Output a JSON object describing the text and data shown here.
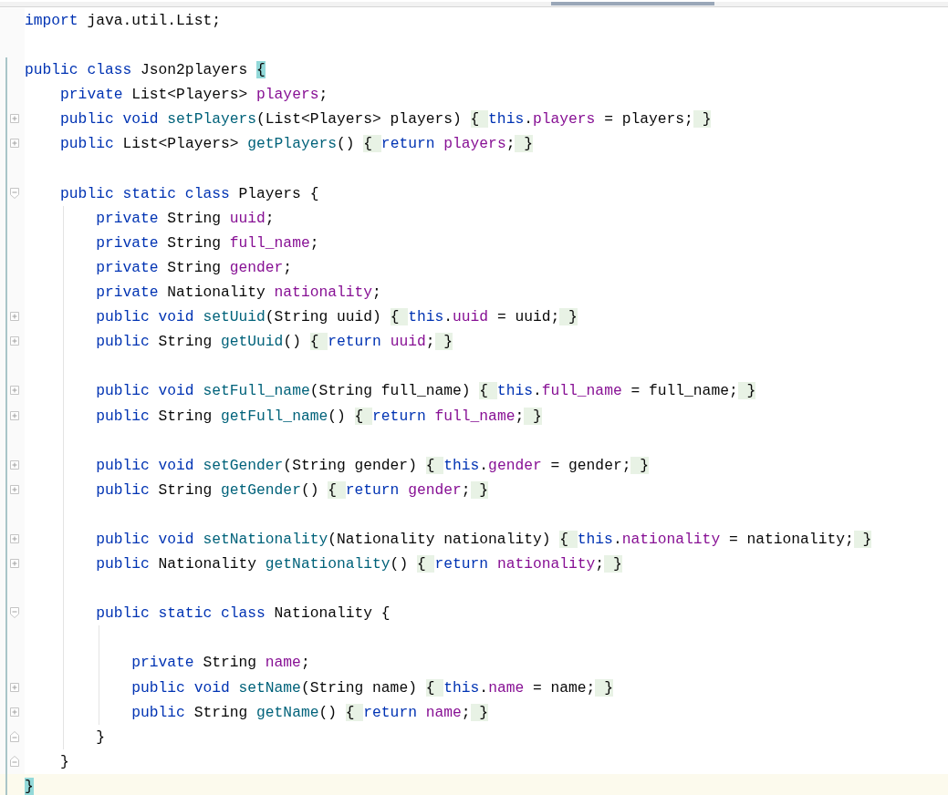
{
  "editor": {
    "lines": [
      {
        "kind": "plain",
        "modified": false,
        "current": false,
        "segments": [
          {
            "kind": "keyword",
            "text": "import"
          },
          {
            "kind": "plain",
            "text": " java.util.List;"
          }
        ]
      },
      {
        "kind": "plain",
        "modified": false,
        "current": false
      },
      {
        "kind": "plain",
        "modified": true,
        "current": false,
        "segments": [
          {
            "kind": "keyword",
            "text": "public class"
          },
          {
            "kind": "plain",
            "text": " Json2players "
          },
          {
            "kind": "match",
            "text": "{"
          }
        ]
      },
      {
        "kind": "plain",
        "modified": true,
        "current": false,
        "segments": [
          {
            "kind": "keyword",
            "text": "    private"
          },
          {
            "kind": "plain",
            "text": " List<Players> "
          },
          {
            "kind": "field",
            "text": "players"
          },
          {
            "kind": "plain",
            "text": ";"
          }
        ]
      },
      {
        "kind": "folded",
        "modified": true,
        "current": false,
        "segments": [
          {
            "kind": "keyword",
            "text": "    public void "
          },
          {
            "kind": "method",
            "text": "setPlayers"
          },
          {
            "kind": "plain",
            "text": "(List<Players> players) "
          },
          {
            "kind": "folded",
            "text": "{ "
          },
          {
            "kind": "keyword",
            "text": "this"
          },
          {
            "kind": "plain",
            "text": "."
          },
          {
            "kind": "field",
            "text": "players"
          },
          {
            "kind": "plain",
            "text": " = players;"
          },
          {
            "kind": "folded",
            "text": " }"
          }
        ]
      },
      {
        "kind": "folded",
        "modified": true,
        "current": false,
        "segments": [
          {
            "kind": "keyword",
            "text": "    public"
          },
          {
            "kind": "plain",
            "text": " List<Players> "
          },
          {
            "kind": "method",
            "text": "getPlayers"
          },
          {
            "kind": "plain",
            "text": "() "
          },
          {
            "kind": "folded",
            "text": "{ "
          },
          {
            "kind": "keyword",
            "text": "return "
          },
          {
            "kind": "field",
            "text": "players"
          },
          {
            "kind": "plain",
            "text": ";"
          },
          {
            "kind": "folded",
            "text": " }"
          }
        ]
      },
      {
        "kind": "plain",
        "modified": true,
        "current": false
      },
      {
        "kind": "start",
        "modified": true,
        "current": false,
        "segments": [
          {
            "kind": "keyword",
            "text": "    public static class"
          },
          {
            "kind": "plain",
            "text": " Players {"
          }
        ]
      },
      {
        "kind": "plain",
        "modified": true,
        "current": false,
        "segments": [
          {
            "kind": "keyword",
            "text": "        private"
          },
          {
            "kind": "plain",
            "text": " String "
          },
          {
            "kind": "field",
            "text": "uuid"
          },
          {
            "kind": "plain",
            "text": ";"
          }
        ]
      },
      {
        "kind": "plain",
        "modified": true,
        "current": false,
        "segments": [
          {
            "kind": "keyword",
            "text": "        private"
          },
          {
            "kind": "plain",
            "text": " String "
          },
          {
            "kind": "field",
            "text": "full_name"
          },
          {
            "kind": "plain",
            "text": ";"
          }
        ]
      },
      {
        "kind": "plain",
        "modified": true,
        "current": false,
        "segments": [
          {
            "kind": "keyword",
            "text": "        private"
          },
          {
            "kind": "plain",
            "text": " String "
          },
          {
            "kind": "field",
            "text": "gender"
          },
          {
            "kind": "plain",
            "text": ";"
          }
        ]
      },
      {
        "kind": "plain",
        "modified": true,
        "current": false,
        "segments": [
          {
            "kind": "keyword",
            "text": "        private"
          },
          {
            "kind": "plain",
            "text": " Nationality "
          },
          {
            "kind": "field",
            "text": "nationality"
          },
          {
            "kind": "plain",
            "text": ";"
          }
        ]
      },
      {
        "kind": "folded",
        "modified": true,
        "current": false,
        "segments": [
          {
            "kind": "keyword",
            "text": "        public void "
          },
          {
            "kind": "method",
            "text": "setUuid"
          },
          {
            "kind": "plain",
            "text": "(String uuid) "
          },
          {
            "kind": "folded",
            "text": "{ "
          },
          {
            "kind": "keyword",
            "text": "this"
          },
          {
            "kind": "plain",
            "text": "."
          },
          {
            "kind": "field",
            "text": "uuid"
          },
          {
            "kind": "plain",
            "text": " = uuid;"
          },
          {
            "kind": "folded",
            "text": " }"
          }
        ]
      },
      {
        "kind": "folded",
        "modified": true,
        "current": false,
        "segments": [
          {
            "kind": "keyword",
            "text": "        public"
          },
          {
            "kind": "plain",
            "text": " String "
          },
          {
            "kind": "method",
            "text": "getUuid"
          },
          {
            "kind": "plain",
            "text": "() "
          },
          {
            "kind": "folded",
            "text": "{ "
          },
          {
            "kind": "keyword",
            "text": "return "
          },
          {
            "kind": "field",
            "text": "uuid"
          },
          {
            "kind": "plain",
            "text": ";"
          },
          {
            "kind": "folded",
            "text": " }"
          }
        ]
      },
      {
        "kind": "plain",
        "modified": true,
        "current": false
      },
      {
        "kind": "folded",
        "modified": true,
        "current": false,
        "segments": [
          {
            "kind": "keyword",
            "text": "        public void "
          },
          {
            "kind": "method",
            "text": "setFull_name"
          },
          {
            "kind": "plain",
            "text": "(String full_name) "
          },
          {
            "kind": "folded",
            "text": "{ "
          },
          {
            "kind": "keyword",
            "text": "this"
          },
          {
            "kind": "plain",
            "text": "."
          },
          {
            "kind": "field",
            "text": "full_name"
          },
          {
            "kind": "plain",
            "text": " = full_name;"
          },
          {
            "kind": "folded",
            "text": " }"
          }
        ]
      },
      {
        "kind": "folded",
        "modified": true,
        "current": false,
        "segments": [
          {
            "kind": "keyword",
            "text": "        public"
          },
          {
            "kind": "plain",
            "text": " String "
          },
          {
            "kind": "method",
            "text": "getFull_name"
          },
          {
            "kind": "plain",
            "text": "() "
          },
          {
            "kind": "folded",
            "text": "{ "
          },
          {
            "kind": "keyword",
            "text": "return "
          },
          {
            "kind": "field",
            "text": "full_name"
          },
          {
            "kind": "plain",
            "text": ";"
          },
          {
            "kind": "folded",
            "text": " }"
          }
        ]
      },
      {
        "kind": "plain",
        "modified": true,
        "current": false
      },
      {
        "kind": "folded",
        "modified": true,
        "current": false,
        "segments": [
          {
            "kind": "keyword",
            "text": "        public void "
          },
          {
            "kind": "method",
            "text": "setGender"
          },
          {
            "kind": "plain",
            "text": "(String gender) "
          },
          {
            "kind": "folded",
            "text": "{ "
          },
          {
            "kind": "keyword",
            "text": "this"
          },
          {
            "kind": "plain",
            "text": "."
          },
          {
            "kind": "field",
            "text": "gender"
          },
          {
            "kind": "plain",
            "text": " = gender;"
          },
          {
            "kind": "folded",
            "text": " }"
          }
        ]
      },
      {
        "kind": "folded",
        "modified": true,
        "current": false,
        "segments": [
          {
            "kind": "keyword",
            "text": "        public"
          },
          {
            "kind": "plain",
            "text": " String "
          },
          {
            "kind": "method",
            "text": "getGender"
          },
          {
            "kind": "plain",
            "text": "() "
          },
          {
            "kind": "folded",
            "text": "{ "
          },
          {
            "kind": "keyword",
            "text": "return "
          },
          {
            "kind": "field",
            "text": "gender"
          },
          {
            "kind": "plain",
            "text": ";"
          },
          {
            "kind": "folded",
            "text": " }"
          }
        ]
      },
      {
        "kind": "plain",
        "modified": true,
        "current": false
      },
      {
        "kind": "folded",
        "modified": true,
        "current": false,
        "segments": [
          {
            "kind": "keyword",
            "text": "        public void "
          },
          {
            "kind": "method",
            "text": "setNationality"
          },
          {
            "kind": "plain",
            "text": "(Nationality nationality) "
          },
          {
            "kind": "folded",
            "text": "{ "
          },
          {
            "kind": "keyword",
            "text": "this"
          },
          {
            "kind": "plain",
            "text": "."
          },
          {
            "kind": "field",
            "text": "nationality"
          },
          {
            "kind": "plain",
            "text": " = nationality;"
          },
          {
            "kind": "folded",
            "text": " }"
          }
        ]
      },
      {
        "kind": "folded",
        "modified": true,
        "current": false,
        "segments": [
          {
            "kind": "keyword",
            "text": "        public"
          },
          {
            "kind": "plain",
            "text": " Nationality "
          },
          {
            "kind": "method",
            "text": "getNationality"
          },
          {
            "kind": "plain",
            "text": "() "
          },
          {
            "kind": "folded",
            "text": "{ "
          },
          {
            "kind": "keyword",
            "text": "return "
          },
          {
            "kind": "field",
            "text": "nationality"
          },
          {
            "kind": "plain",
            "text": ";"
          },
          {
            "kind": "folded",
            "text": " }"
          }
        ]
      },
      {
        "kind": "plain",
        "modified": true,
        "current": false
      },
      {
        "kind": "start",
        "modified": true,
        "current": false,
        "segments": [
          {
            "kind": "keyword",
            "text": "        public static class"
          },
          {
            "kind": "plain",
            "text": " Nationality {"
          }
        ]
      },
      {
        "kind": "plain",
        "modified": true,
        "current": false
      },
      {
        "kind": "plain",
        "modified": true,
        "current": false,
        "segments": [
          {
            "kind": "keyword",
            "text": "            private"
          },
          {
            "kind": "plain",
            "text": " String "
          },
          {
            "kind": "field",
            "text": "name"
          },
          {
            "kind": "plain",
            "text": ";"
          }
        ]
      },
      {
        "kind": "folded",
        "modified": true,
        "current": false,
        "segments": [
          {
            "kind": "keyword",
            "text": "            public void "
          },
          {
            "kind": "method",
            "text": "setName"
          },
          {
            "kind": "plain",
            "text": "(String name) "
          },
          {
            "kind": "folded",
            "text": "{ "
          },
          {
            "kind": "keyword",
            "text": "this"
          },
          {
            "kind": "plain",
            "text": "."
          },
          {
            "kind": "field",
            "text": "name"
          },
          {
            "kind": "plain",
            "text": " = name;"
          },
          {
            "kind": "folded",
            "text": " }"
          }
        ]
      },
      {
        "kind": "folded",
        "modified": true,
        "current": false,
        "segments": [
          {
            "kind": "keyword",
            "text": "            public"
          },
          {
            "kind": "plain",
            "text": " String "
          },
          {
            "kind": "method",
            "text": "getName"
          },
          {
            "kind": "plain",
            "text": "() "
          },
          {
            "kind": "folded",
            "text": "{ "
          },
          {
            "kind": "keyword",
            "text": "return "
          },
          {
            "kind": "field",
            "text": "name"
          },
          {
            "kind": "plain",
            "text": ";"
          },
          {
            "kind": "folded",
            "text": " }"
          }
        ]
      },
      {
        "kind": "end",
        "modified": true,
        "current": false,
        "segments": [
          {
            "kind": "plain",
            "text": "        }"
          }
        ]
      },
      {
        "kind": "end",
        "modified": true,
        "current": false,
        "segments": [
          {
            "kind": "plain",
            "text": "    }"
          }
        ]
      },
      {
        "kind": "plain",
        "modified": true,
        "current": true,
        "segments": [
          {
            "kind": "match",
            "text": "}"
          }
        ]
      }
    ]
  }
}
